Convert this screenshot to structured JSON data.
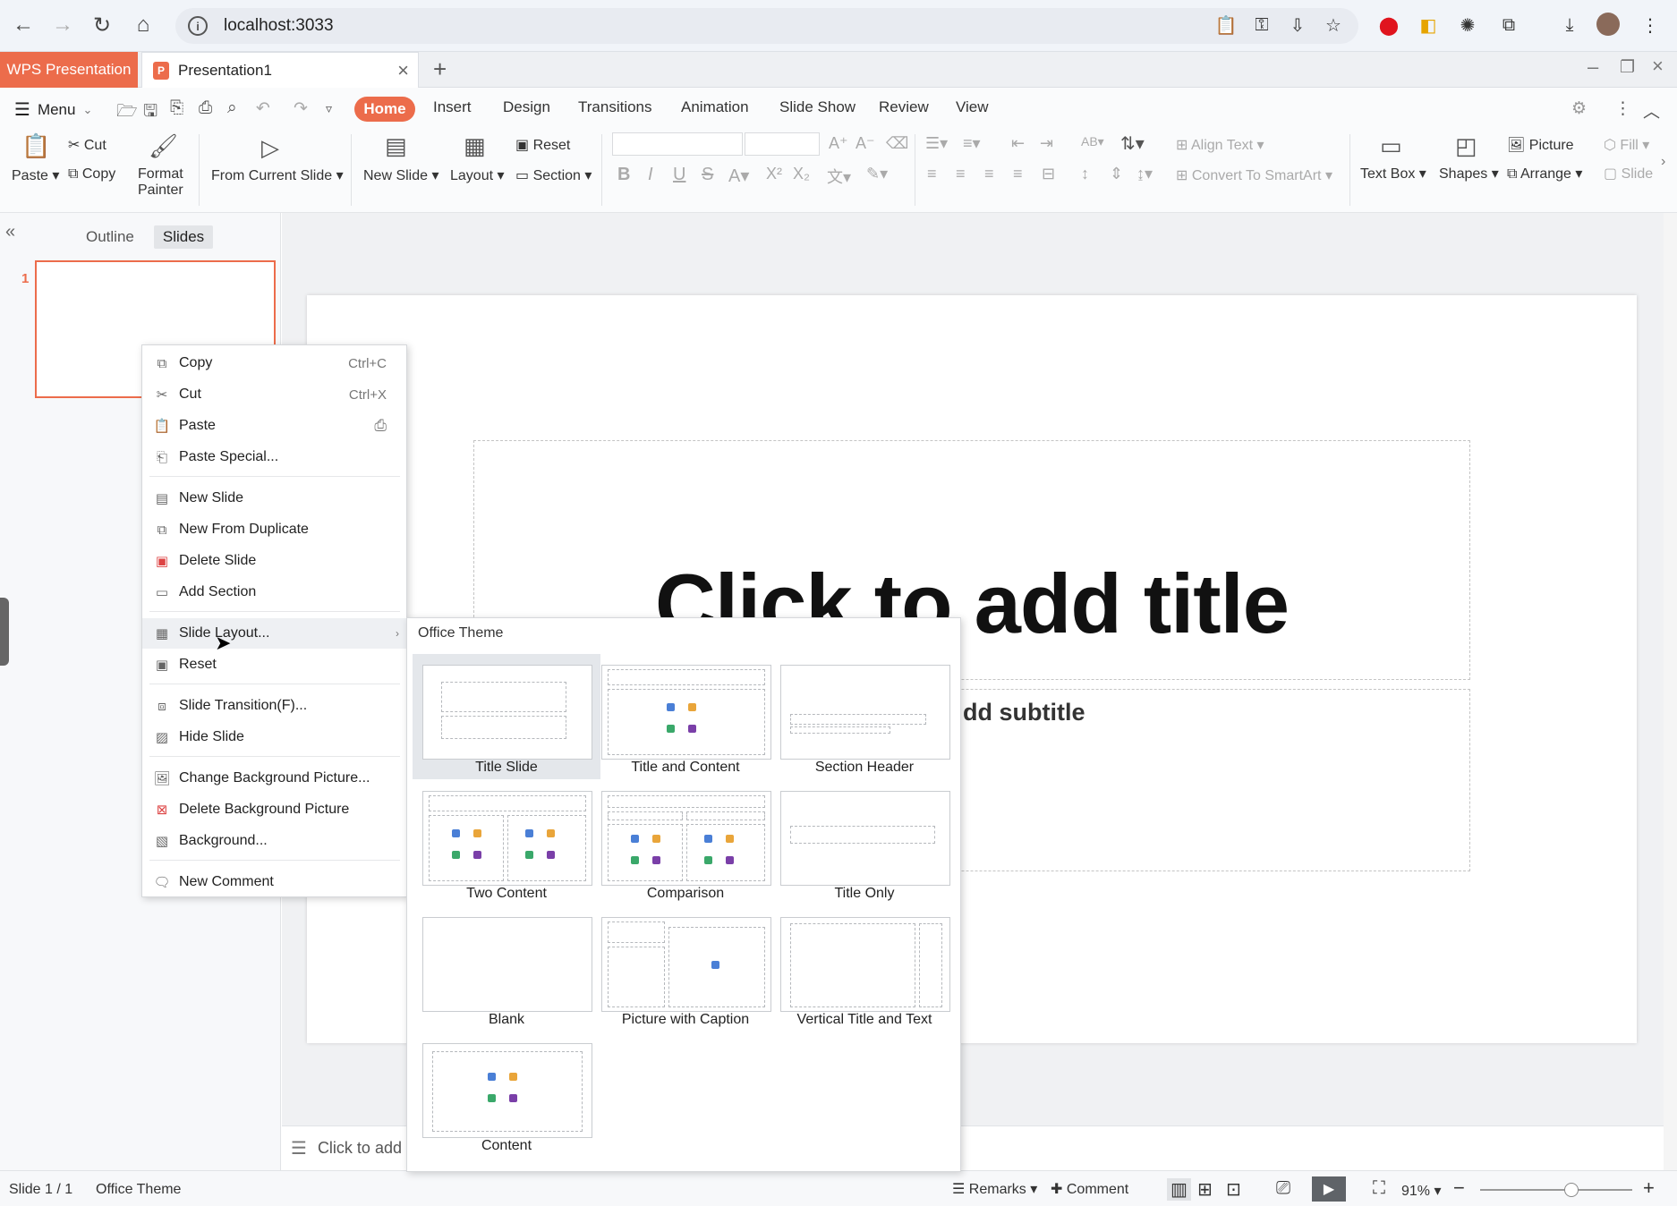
{
  "browser": {
    "url": "localhost:3033"
  },
  "tabbar": {
    "app_tab": "WPS Presentation",
    "doc_tab": "Presentation1"
  },
  "menubar": {
    "menu_label": "Menu",
    "tabs": [
      "Home",
      "Insert",
      "Design",
      "Transitions",
      "Animation",
      "Slide Show",
      "Review",
      "View"
    ]
  },
  "ribbon": {
    "paste": "Paste",
    "cut": "Cut",
    "copy": "Copy",
    "format_painter_1": "Format",
    "format_painter_2": "Painter",
    "from_current_slide": "From Current Slide",
    "new_slide": "New Slide",
    "layout": "Layout",
    "reset": "Reset",
    "section": "Section",
    "align_text": "Align Text",
    "convert_smartart": "Convert To SmartArt",
    "text_box": "Text Box",
    "shapes": "Shapes",
    "picture": "Picture",
    "arrange": "Arrange",
    "fill": "Fill",
    "slide": "Slide"
  },
  "left_panel": {
    "tab_outline": "Outline",
    "tab_slides": "Slides",
    "slide_number": "1"
  },
  "slide": {
    "title_placeholder": "Click to add title",
    "subtitle_placeholder": "dd subtitle",
    "notes_placeholder": "Click to add"
  },
  "context_menu": {
    "items": [
      {
        "label": "Copy",
        "shortcut": "Ctrl+C",
        "icon": "copy-icon"
      },
      {
        "label": "Cut",
        "shortcut": "Ctrl+X",
        "icon": "scissors-icon"
      },
      {
        "label": "Paste",
        "shortcut": "",
        "icon": "paste-icon"
      },
      {
        "label": "Paste Special...",
        "shortcut": "",
        "icon": "paste-special-icon"
      },
      {
        "label": "New Slide",
        "icon": "new-slide-icon"
      },
      {
        "label": "New From Duplicate",
        "icon": "duplicate-icon"
      },
      {
        "label": "Delete Slide",
        "icon": "delete-slide-icon"
      },
      {
        "label": "Add Section",
        "icon": "section-icon"
      },
      {
        "label": "Slide Layout...",
        "icon": "layout-icon"
      },
      {
        "label": "Reset",
        "icon": "reset-icon"
      },
      {
        "label": "Slide Transition(F)...",
        "icon": "transition-icon"
      },
      {
        "label": "Hide Slide",
        "icon": "hide-slide-icon"
      },
      {
        "label": "Change Background Picture...",
        "icon": "picture-icon"
      },
      {
        "label": "Delete Background Picture",
        "icon": "delete-picture-icon"
      },
      {
        "label": "Background...",
        "icon": "background-icon"
      },
      {
        "label": "New Comment",
        "icon": "comment-icon"
      }
    ]
  },
  "layout_submenu": {
    "heading": "Office Theme",
    "layouts": [
      "Title Slide",
      "Title and Content",
      "Section Header",
      "Two Content",
      "Comparison",
      "Title Only",
      "Blank",
      "Picture with Caption",
      "Vertical Title and Text",
      "Content"
    ],
    "selected": "Title Slide"
  },
  "status_bar": {
    "slide_counter": "Slide 1 / 1",
    "theme": "Office Theme",
    "remarks": "Remarks",
    "comment": "Comment",
    "zoom": "91%",
    "zoom_level": 0.6
  },
  "colors": {
    "accent": "#ec6c4b"
  }
}
